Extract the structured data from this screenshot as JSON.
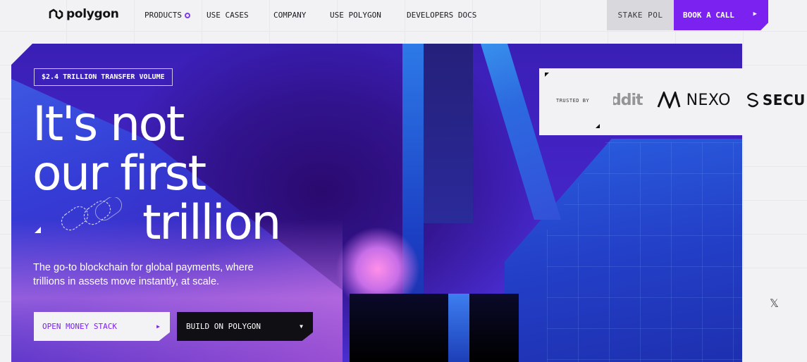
{
  "nav": {
    "logo_text": "polygon",
    "links": [
      {
        "label": "PRODUCTS"
      },
      {
        "label": "USE CASES"
      },
      {
        "label": "COMPANY"
      },
      {
        "label": "USE POLYGON"
      },
      {
        "label": "DEVELOPERS DOCS"
      }
    ],
    "stake_label": "STAKE POL",
    "book_label": "BOOK A CALL"
  },
  "hero": {
    "badge": "$2.4 TRILLION TRANSFER VOLUME",
    "headline_line1": "It's not",
    "headline_line2": "our first",
    "headline_line3": "trillion",
    "subtext": "The go-to blockchain for global payments, where trillions in assets move instantly, at scale.",
    "cta_primary": "OPEN MONEY STACK",
    "cta_secondary": "BUILD ON POLYGON"
  },
  "trusted": {
    "label": "TRUSTED BY",
    "logos": [
      "ddit",
      "NEXO",
      "SECU"
    ]
  },
  "social": {
    "x_icon": "x-icon"
  },
  "colors": {
    "accent": "#7b22f0",
    "dark_button": "#101014",
    "page_bg": "#f2f1f4"
  }
}
